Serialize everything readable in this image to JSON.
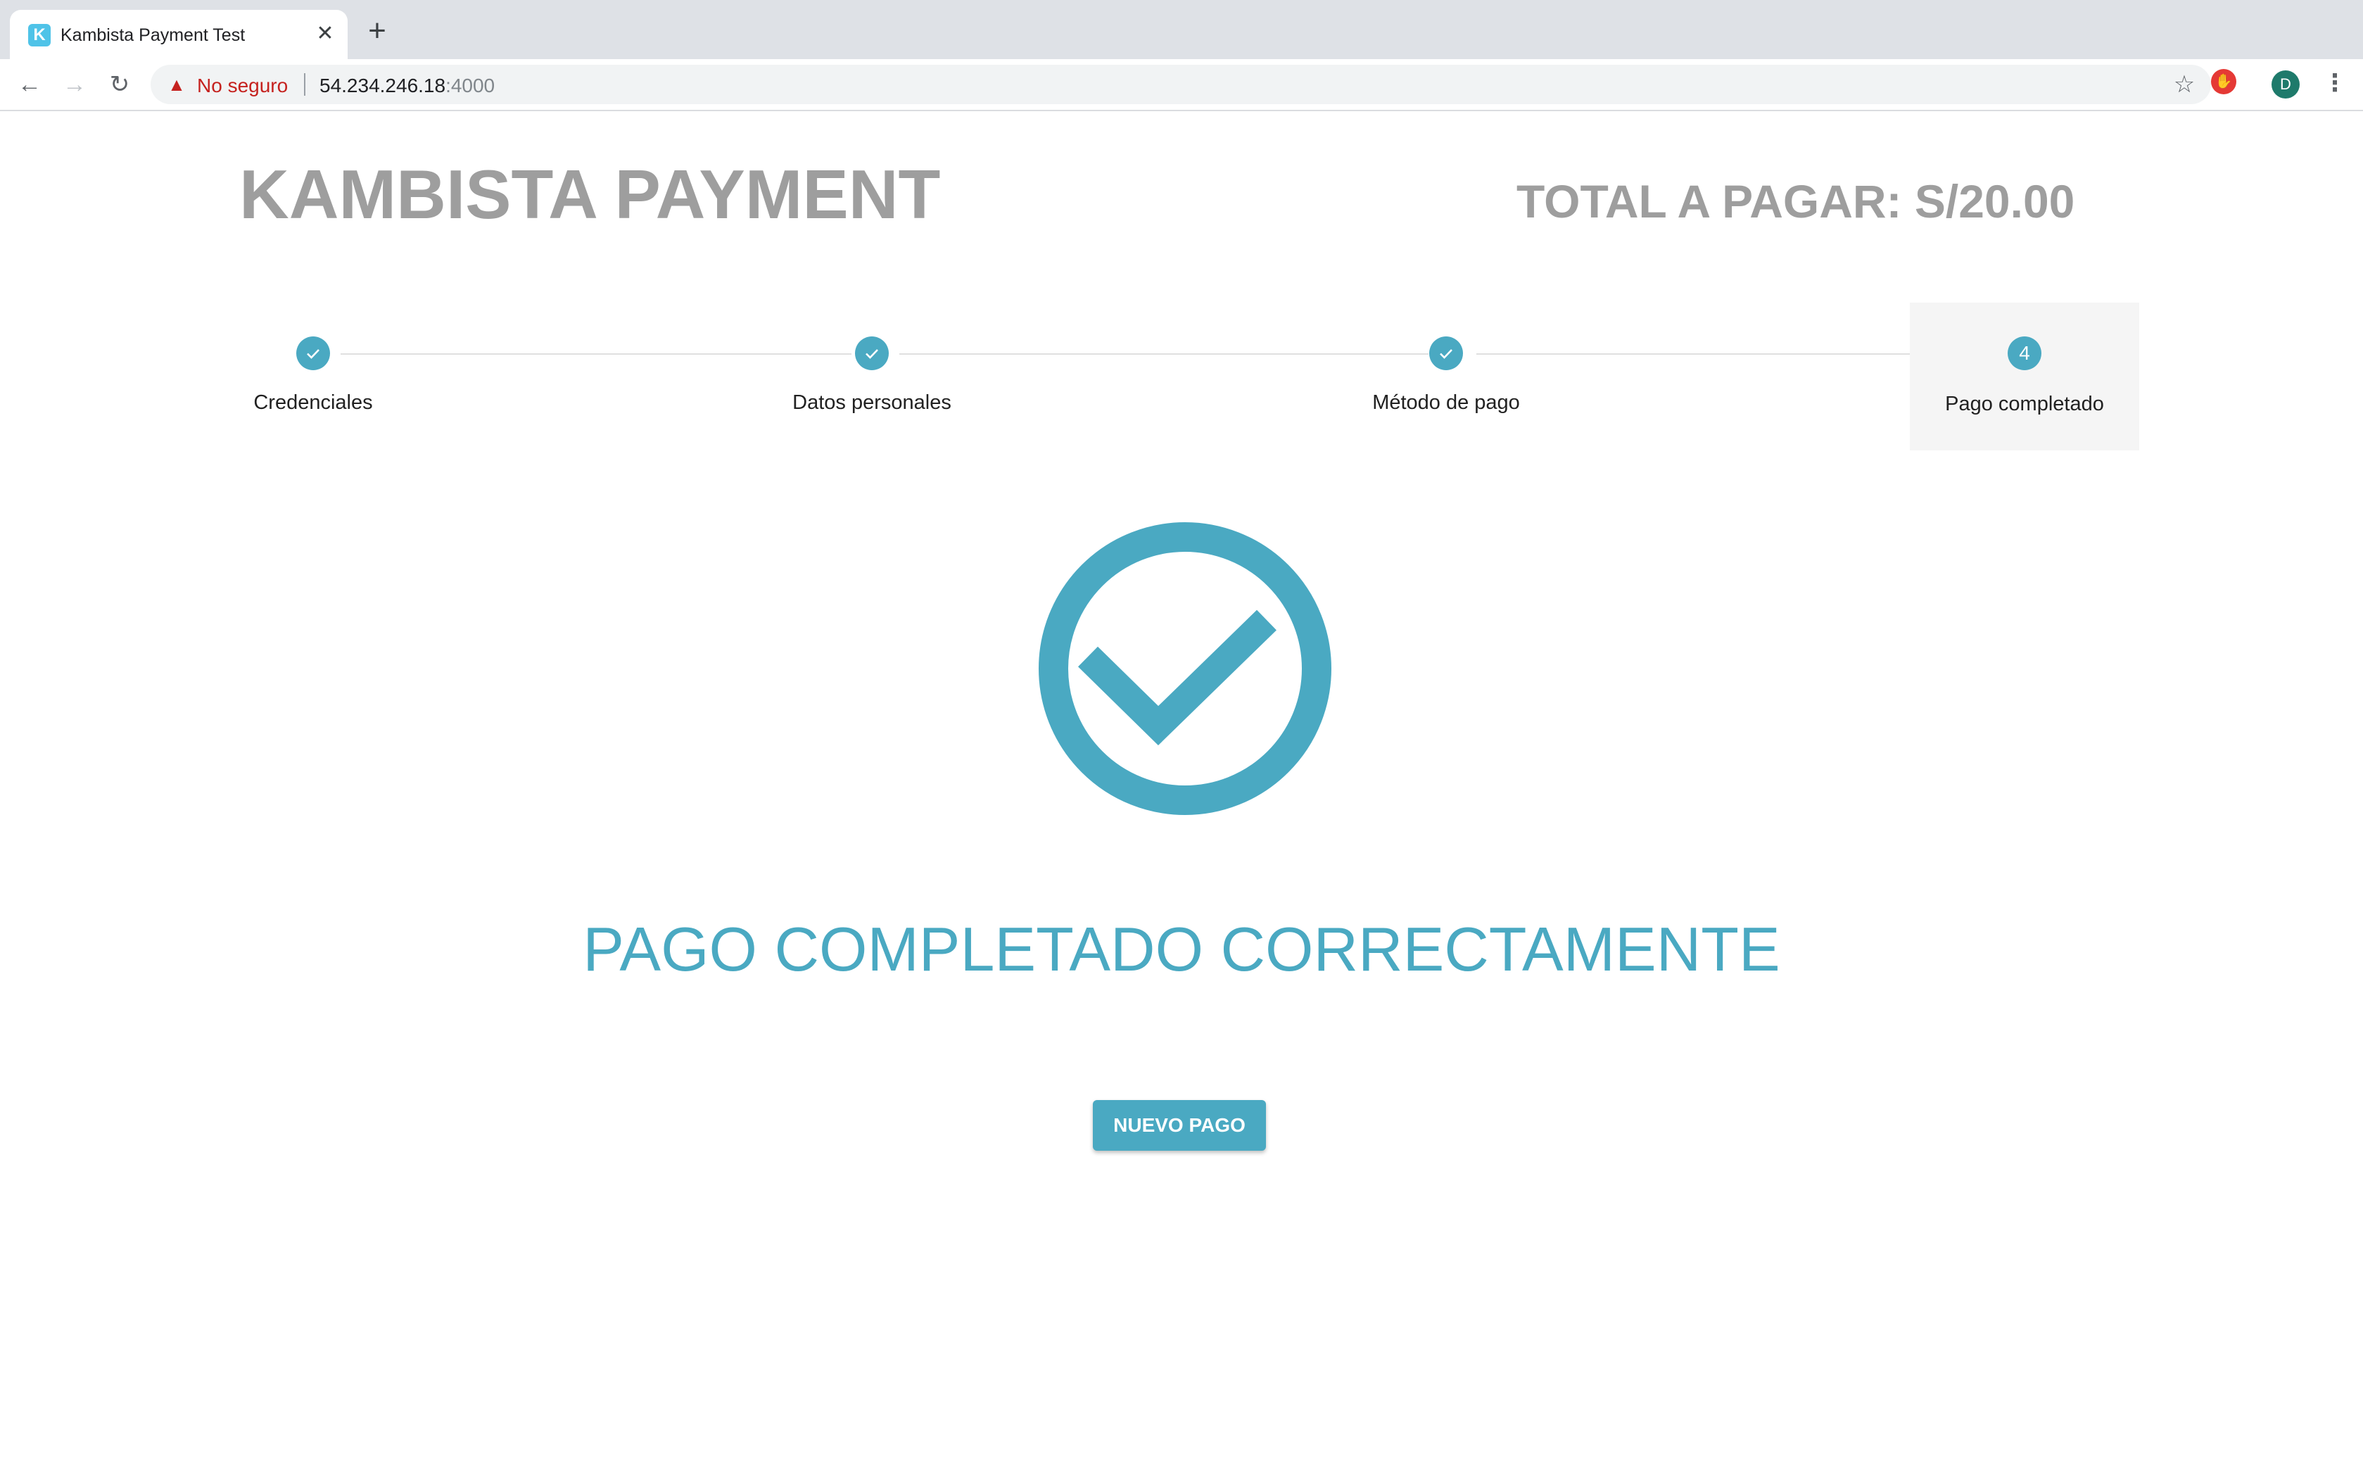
{
  "browser": {
    "tab_title": "Kambista Payment Test",
    "favicon_letter": "K",
    "close_glyph": "✕",
    "new_tab_glyph": "+",
    "back_glyph": "←",
    "forward_glyph": "→",
    "reload_glyph": "↻",
    "security_label": "No seguro",
    "url_host": "54.234.246.18",
    "url_port": ":4000",
    "star_glyph": "☆",
    "extension_glyph": "✋",
    "avatar_letter": "D",
    "menu_glyph": "⋮"
  },
  "header": {
    "brand": "KAMBISTA PAYMENT",
    "total": "TOTAL A PAGAR: S/20.00"
  },
  "stepper": {
    "steps": [
      {
        "label": "Credenciales",
        "state": "done"
      },
      {
        "label": "Datos personales",
        "state": "done"
      },
      {
        "label": "Método de pago",
        "state": "done"
      },
      {
        "label": "Pago completado",
        "state": "active",
        "number": "4"
      }
    ]
  },
  "result": {
    "title": "PAGO COMPLETADO CORRECTAMENTE",
    "button_label": "NUEVO PAGO"
  },
  "colors": {
    "accent": "#4aa9c2",
    "heading_gray": "#9e9e9e"
  }
}
